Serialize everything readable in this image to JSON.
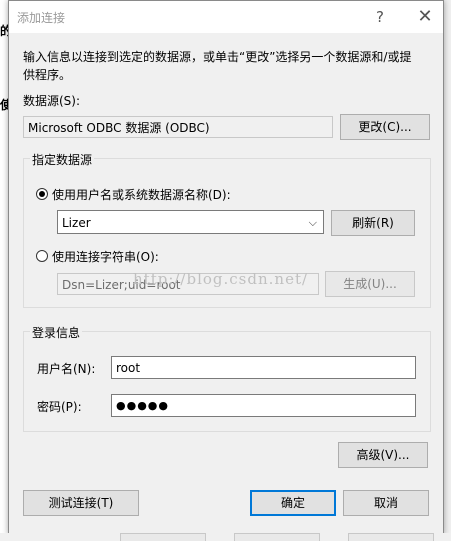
{
  "window": {
    "title": "添加连接",
    "help_glyph": "?",
    "close_glyph": "✕"
  },
  "background": {
    "glyph_1": "的",
    "glyph_2": "使"
  },
  "intro": "输入信息以连接到选定的数据源，或单击“更改”选择另一个数据源和/或提供程序。",
  "datasource": {
    "label": "数据源(S):",
    "value": "Microsoft ODBC 数据源 (ODBC)",
    "change_button": "更改(C)..."
  },
  "specify_group": {
    "title": "指定数据源",
    "radio_dsn_label": "使用用户名或系统数据源名称(D):",
    "radio_dsn_checked": true,
    "dsn_value": "Lizer",
    "refresh_button": "刷新(R)",
    "radio_connstr_label": "使用连接字符串(O):",
    "radio_connstr_checked": false,
    "connstr_value": "Dsn=Lizer;uid=root",
    "build_button": "生成(U)..."
  },
  "login_group": {
    "title": "登录信息",
    "username_label": "用户名(N):",
    "username_value": "root",
    "password_label": "密码(P):",
    "password_value": "●●●●●"
  },
  "advanced_button": "高级(V)...",
  "footer": {
    "test_button": "测试连接(T)",
    "ok_button": "确定",
    "cancel_button": "取消"
  },
  "watermark": "http://blog.csdn.net/",
  "icons": {
    "dropdown": "chevron-down-icon",
    "help": "help-icon",
    "close": "close-icon"
  },
  "colors": {
    "primary_border": "#0078d7",
    "disabled_text": "#838383"
  }
}
